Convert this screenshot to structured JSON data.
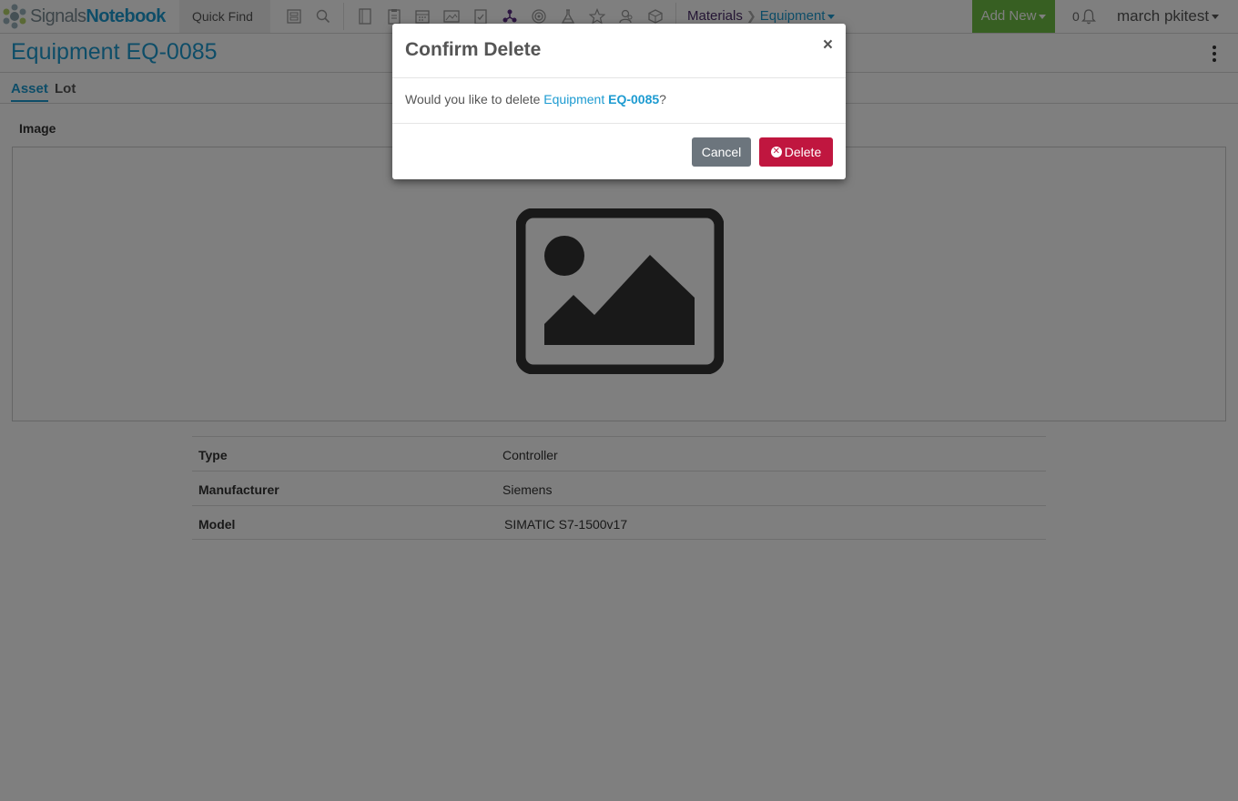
{
  "app": {
    "logo_part1": "Signals",
    "logo_part2": "Notebook",
    "quick_find": "Quick Find"
  },
  "nav_icons": [
    "form-icon",
    "search-icon",
    "notebook-icon",
    "clipboard-icon",
    "calendar-icon",
    "gallery-icon",
    "task-icon",
    "molecule-icon",
    "target-icon",
    "flask-icon",
    "star-icon",
    "users-icon",
    "cube-icon"
  ],
  "breadcrumb": {
    "item1": "Materials",
    "item2": "Equipment"
  },
  "add_new": "Add New",
  "notifications_count": "0",
  "user_name": "march pkitest",
  "page": {
    "title": "Equipment EQ-0085",
    "tabs": [
      {
        "label": "Asset",
        "active": true
      },
      {
        "label": "Lot",
        "active": false
      }
    ],
    "image_label": "Image"
  },
  "properties": [
    {
      "key": "Type",
      "value": "Controller"
    },
    {
      "key": "Manufacturer",
      "value": "Siemens"
    },
    {
      "key": "Model",
      "value": "SIMATIC S7-1500v17"
    }
  ],
  "modal": {
    "title": "Confirm Delete",
    "close": "×",
    "body_prefix": "Would you like to delete ",
    "body_link_type": "Equipment",
    "body_link_id": "EQ-0085",
    "body_suffix": "?",
    "cancel_label": "Cancel",
    "delete_label": "Delete"
  },
  "colors": {
    "brand_blue": "#1d9bd1",
    "add_new_green": "#6fbe44",
    "delete_red": "#c0163f",
    "cancel_gray": "#6c757d"
  }
}
